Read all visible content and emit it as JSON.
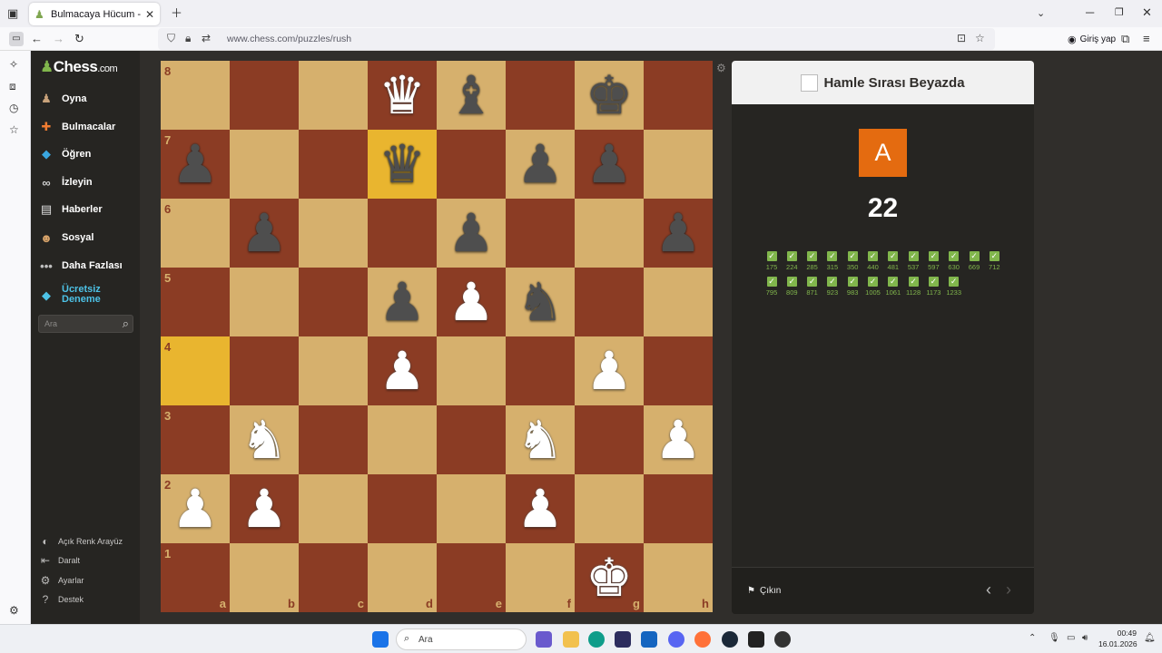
{
  "browser": {
    "tab_title": "Bulmacaya Hücum - Satranç Bu",
    "url": "www.chess.com/puzzles/rush",
    "login_label": "Giriş yap"
  },
  "nav": {
    "logo": "Chess",
    "logo_suffix": ".com",
    "items": [
      {
        "label": "Oyna",
        "icon": "pawn-play-icon"
      },
      {
        "label": "Bulmacalar",
        "icon": "puzzle-icon"
      },
      {
        "label": "Öğren",
        "icon": "learn-cube-icon"
      },
      {
        "label": "İzleyin",
        "icon": "binoculars-icon"
      },
      {
        "label": "Haberler",
        "icon": "news-icon"
      },
      {
        "label": "Sosyal",
        "icon": "social-icon"
      },
      {
        "label": "Daha Fazlası",
        "icon": "more-dots-icon"
      }
    ],
    "premium_line1": "Ücretsiz",
    "premium_line2": "Deneme",
    "search_placeholder": "Ara",
    "bottom": [
      {
        "label": "Açık Renk Arayüz",
        "icon": "theme-icon"
      },
      {
        "label": "Daralt",
        "icon": "collapse-icon"
      },
      {
        "label": "Ayarlar",
        "icon": "settings-icon"
      },
      {
        "label": "Destek",
        "icon": "help-icon"
      }
    ]
  },
  "board": {
    "ranks": [
      "8",
      "7",
      "6",
      "5",
      "4",
      "3",
      "2",
      "1"
    ],
    "files": [
      "a",
      "b",
      "c",
      "d",
      "e",
      "f",
      "g",
      "h"
    ],
    "highlight": [
      "d7",
      "a4"
    ],
    "pieces": {
      "d8": {
        "glyph": "♛",
        "color": "w",
        "name": "white-queen"
      },
      "e8": {
        "glyph": "♝",
        "color": "b",
        "name": "black-bishop"
      },
      "g8": {
        "glyph": "♚",
        "color": "b",
        "name": "black-king"
      },
      "a7": {
        "glyph": "♟",
        "color": "b",
        "name": "black-pawn"
      },
      "d7": {
        "glyph": "♛",
        "color": "b",
        "name": "black-queen"
      },
      "f7": {
        "glyph": "♟",
        "color": "b",
        "name": "black-pawn"
      },
      "g7": {
        "glyph": "♟",
        "color": "b",
        "name": "black-pawn"
      },
      "b6": {
        "glyph": "♟",
        "color": "b",
        "name": "black-pawn"
      },
      "e6": {
        "glyph": "♟",
        "color": "b",
        "name": "black-pawn"
      },
      "h6": {
        "glyph": "♟",
        "color": "b",
        "name": "black-pawn"
      },
      "d5": {
        "glyph": "♟",
        "color": "b",
        "name": "black-pawn"
      },
      "e5": {
        "glyph": "♟",
        "color": "w",
        "name": "white-pawn"
      },
      "f5": {
        "glyph": "♞",
        "color": "b",
        "name": "black-knight"
      },
      "d4": {
        "glyph": "♟",
        "color": "w",
        "name": "white-pawn"
      },
      "g4": {
        "glyph": "♟",
        "color": "w",
        "name": "white-pawn"
      },
      "b3": {
        "glyph": "♞",
        "color": "w",
        "name": "white-knight"
      },
      "f3": {
        "glyph": "♞",
        "color": "w",
        "name": "white-knight"
      },
      "h3": {
        "glyph": "♟",
        "color": "w",
        "name": "white-pawn"
      },
      "a2": {
        "glyph": "♟",
        "color": "w",
        "name": "white-pawn"
      },
      "b2": {
        "glyph": "♟",
        "color": "w",
        "name": "white-pawn"
      },
      "f2": {
        "glyph": "♟",
        "color": "w",
        "name": "white-pawn"
      },
      "g1": {
        "glyph": "♚",
        "color": "w",
        "name": "white-king"
      }
    }
  },
  "panel": {
    "turn_text": "Hamle Sırası Beyazda",
    "badge_letter": "A",
    "badge_color": "#e46b10",
    "score": "22",
    "solved": [
      "175",
      "224",
      "285",
      "315",
      "350",
      "440",
      "481",
      "537",
      "597",
      "630",
      "669",
      "712",
      "795",
      "809",
      "871",
      "923",
      "983",
      "1005",
      "1061",
      "1128",
      "1173",
      "1233"
    ],
    "quit_label": "Çıkın"
  },
  "taskbar": {
    "search_placeholder": "Ara",
    "time": "00:49",
    "date": "16.01.2026"
  }
}
